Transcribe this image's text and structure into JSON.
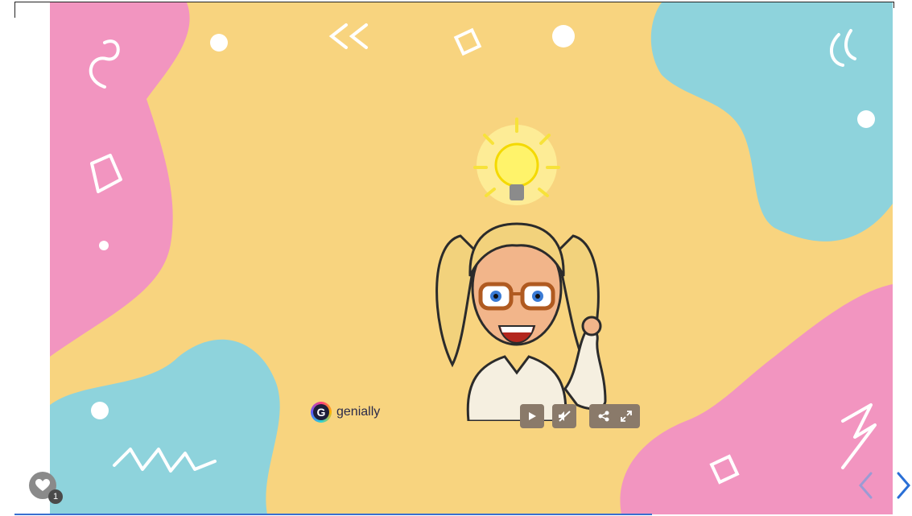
{
  "branding": {
    "logo_letter": "G",
    "logo_word": "genially"
  },
  "controls": {
    "play": "play-icon",
    "mute": "mute-icon",
    "share": "share-icon",
    "fullscreen": "fullscreen-icon"
  },
  "like": {
    "count": "1"
  },
  "navigation": {
    "prev": "chevron-left-icon",
    "next": "chevron-right-icon"
  },
  "colors": {
    "slide_background": "#f8d47f",
    "pink_blob": "#f295c0",
    "cyan_blob": "#8ed3dc",
    "control_bg": "#8a7a6a",
    "progress": "#3a6fd0",
    "nav_next": "#2a6fd6",
    "nav_prev": "#9b9bd4"
  }
}
